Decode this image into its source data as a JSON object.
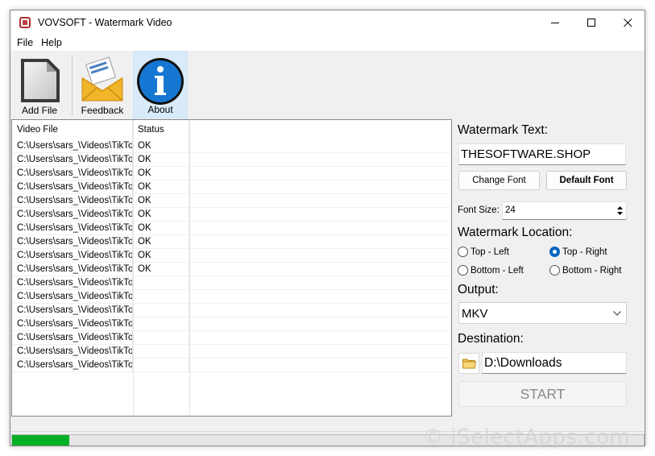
{
  "window": {
    "title": "VOVSOFT - Watermark Video"
  },
  "menu": {
    "items": [
      "File",
      "Help"
    ]
  },
  "toolbar": {
    "add_file": "Add File",
    "feedback": "Feedback",
    "about": "About"
  },
  "list": {
    "columns": [
      "Video File",
      "Status"
    ],
    "rows": [
      {
        "file": "C:\\Users\\sars_\\Videos\\TikTok",
        "status": "OK"
      },
      {
        "file": "C:\\Users\\sars_\\Videos\\TikTok",
        "status": "OK"
      },
      {
        "file": "C:\\Users\\sars_\\Videos\\TikTok",
        "status": "OK"
      },
      {
        "file": "C:\\Users\\sars_\\Videos\\TikTok",
        "status": "OK"
      },
      {
        "file": "C:\\Users\\sars_\\Videos\\TikTok",
        "status": "OK"
      },
      {
        "file": "C:\\Users\\sars_\\Videos\\TikTok",
        "status": "OK"
      },
      {
        "file": "C:\\Users\\sars_\\Videos\\TikTok",
        "status": "OK"
      },
      {
        "file": "C:\\Users\\sars_\\Videos\\TikTok",
        "status": "OK"
      },
      {
        "file": "C:\\Users\\sars_\\Videos\\TikTok",
        "status": "OK"
      },
      {
        "file": "C:\\Users\\sars_\\Videos\\TikTok",
        "status": "OK"
      },
      {
        "file": "C:\\Users\\sars_\\Videos\\TikTok",
        "status": ""
      },
      {
        "file": "C:\\Users\\sars_\\Videos\\TikTok",
        "status": ""
      },
      {
        "file": "C:\\Users\\sars_\\Videos\\TikTok",
        "status": ""
      },
      {
        "file": "C:\\Users\\sars_\\Videos\\TikTok",
        "status": ""
      },
      {
        "file": "C:\\Users\\sars_\\Videos\\TikTok",
        "status": ""
      },
      {
        "file": "C:\\Users\\sars_\\Videos\\TikTok",
        "status": ""
      },
      {
        "file": "C:\\Users\\sars_\\Videos\\TikTok",
        "status": ""
      }
    ]
  },
  "settings": {
    "watermark_text_label": "Watermark Text:",
    "watermark_text_value": "THESOFTWARE.SHOP",
    "change_font": "Change Font",
    "default_font": "Default Font",
    "font_size_label": "Font Size:",
    "font_size_value": "24",
    "location_label": "Watermark Location:",
    "locations": {
      "top_left": "Top - Left",
      "top_right": "Top - Right",
      "bottom_left": "Bottom - Left",
      "bottom_right": "Bottom - Right"
    },
    "selected_location": "Top - Right",
    "output_label": "Output:",
    "output_value": "MKV",
    "destination_label": "Destination:",
    "destination_value": "D:\\Downloads",
    "start": "START"
  },
  "progress": {
    "fraction": 0.09
  },
  "watermark": {
    "text": "© iSelectApps.com"
  },
  "colors": {
    "accent": "#0067c0",
    "progress": "#06b025"
  }
}
